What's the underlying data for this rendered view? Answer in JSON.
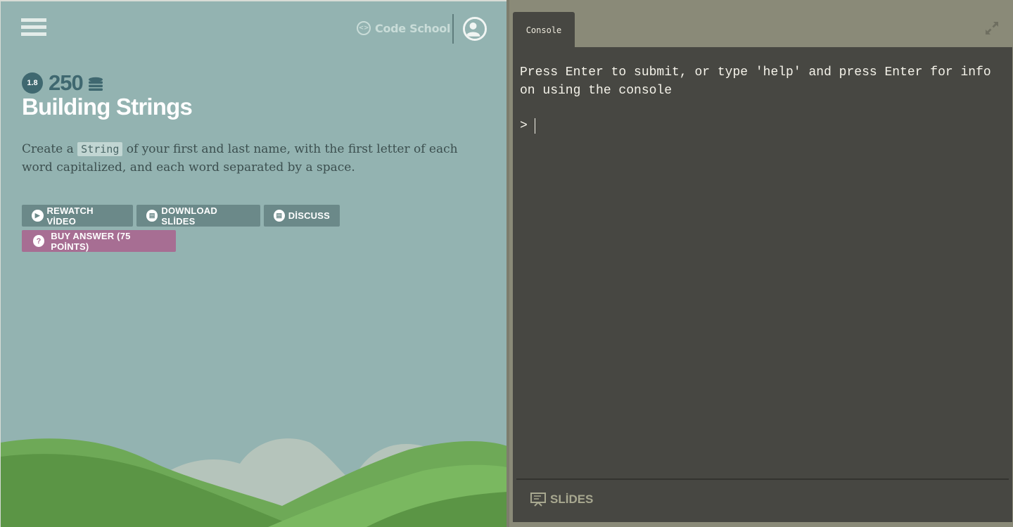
{
  "header": {
    "brand_name": "Code School",
    "brand_logo_glyph": "<>"
  },
  "challenge": {
    "level": "1.8",
    "points": "250",
    "title": "Building Strings",
    "instructions_before": "Create a ",
    "instructions_code": "String",
    "instructions_after": " of your first and last name, with the first letter of each word capitalized, and each word separated by a space."
  },
  "actions": {
    "rewatch_label": "REWATCH VİDEO",
    "download_label": "DOWNLOAD SLİDES",
    "discuss_label": "DİSCUSS",
    "buy_label": "BUY ANSWER (75 POİNTS)"
  },
  "console": {
    "tab_label": "Console",
    "message": "Press Enter to submit, or type 'help' and press Enter for info on using the console",
    "prompt": ">",
    "slides_label": "SLİDES"
  },
  "colors": {
    "left_bg": "#93b3b1",
    "console_bg": "#474742",
    "buy_accent": "#a76e93",
    "button_bg": "#6b8989",
    "badge_bg": "#3f6870"
  }
}
